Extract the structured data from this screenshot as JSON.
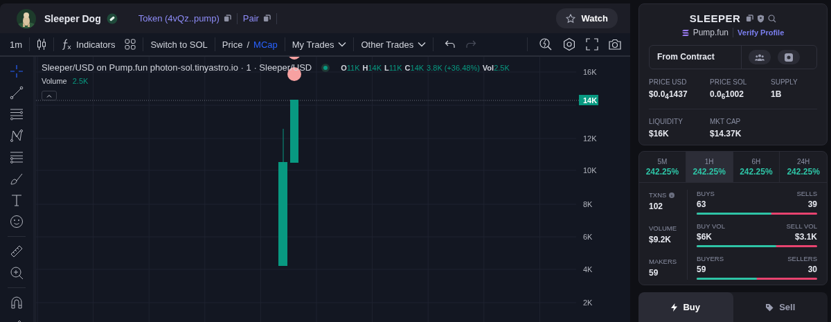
{
  "header": {
    "name": "Sleeper Dog",
    "token_link": "Token (4vQz..pump)",
    "pair_link": "Pair",
    "watch_button": "Watch"
  },
  "toolbar": {
    "interval": "1m",
    "indicators": "Indicators",
    "switch": "Switch to SOL",
    "price_modes": [
      {
        "label": "Price",
        "selected": false
      },
      {
        "label": "MCap",
        "selected": true
      }
    ],
    "separator": "/",
    "dropdowns": [
      "My Trades",
      "Other Trades"
    ]
  },
  "chart": {
    "legend_title": "Sleeper/USD on Pump.fun photon-sol.tinyastro.io · 1 · Sleeper/USD",
    "ohlc": [
      {
        "key": "O",
        "value": "11K"
      },
      {
        "key": "H",
        "value": "14K"
      },
      {
        "key": "L",
        "value": "11K"
      },
      {
        "key": "C",
        "value": "14K"
      }
    ],
    "change": "3.8K (+36.48%)",
    "vol_key": "Vol",
    "vol_value": "2.5K",
    "volume_label": "Volume",
    "volume_value": "2.5K",
    "y_labels": [
      "16K",
      "12K",
      "10K",
      "8K",
      "6K",
      "4K",
      "2K"
    ],
    "price_tag": "14K"
  },
  "token": {
    "symbol": "SLEEPER",
    "platform": "Pump.fun",
    "verify_link": "Verify Profile",
    "contract_label": "From Contract",
    "stats": [
      {
        "label": "PRICE USD",
        "value": "$0.0$_{4}$1437"
      },
      {
        "label": "PRICE SOL",
        "value": "0.0$_{6}$1002"
      },
      {
        "label": "SUPPLY",
        "value": "1B"
      },
      {
        "label": "LIQUIDITY",
        "value": "$16K"
      },
      {
        "label": "MKT CAP",
        "value": "$14.37K"
      }
    ]
  },
  "timeframes": [
    {
      "label": "5M",
      "change": "242.25%",
      "selected": false
    },
    {
      "label": "1H",
      "change": "242.25%",
      "selected": true
    },
    {
      "label": "6H",
      "change": "242.25%",
      "selected": false
    },
    {
      "label": "24H",
      "change": "242.25%",
      "selected": false
    }
  ],
  "activity": {
    "totals": [
      {
        "label": "TXNS",
        "value": "102"
      },
      {
        "label": "VOLUME",
        "value": "$9.2K"
      },
      {
        "label": "MAKERS",
        "value": "59"
      }
    ],
    "splits": [
      {
        "left_label": "BUYS",
        "left_value": "63",
        "right_label": "SELLS",
        "right_value": "39",
        "level": 0.62
      },
      {
        "left_label": "BUY VOL",
        "left_value": "$6K",
        "right_label": "SELL VOL",
        "right_value": "$3.1K",
        "level": 0.66
      },
      {
        "left_label": "BUYERS",
        "left_value": "59",
        "right_label": "SELLERS",
        "right_value": "30",
        "level": 0.5
      }
    ]
  },
  "trade_tabs": [
    {
      "label": "Buy",
      "selected": true
    },
    {
      "label": "Sell",
      "selected": false
    }
  ]
}
